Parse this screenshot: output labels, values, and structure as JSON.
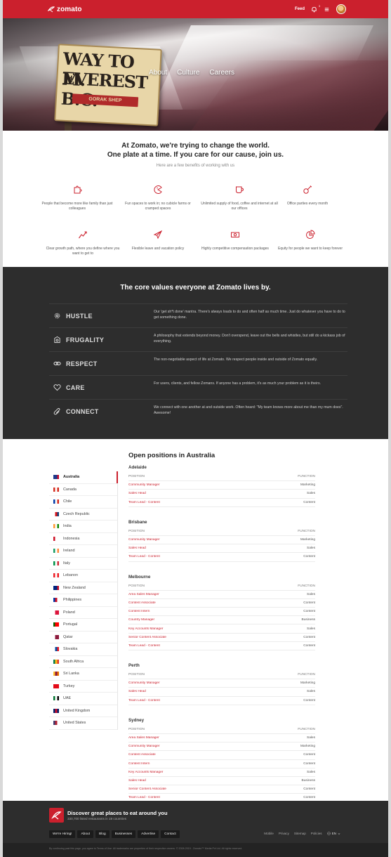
{
  "nav": {
    "logo": "zomato",
    "feed": "Feed",
    "notif_count": "3"
  },
  "hero": {
    "sign_line1": "WAY TO M.",
    "sign_line2": "EVEREST B.C.",
    "sign_line3": "GORAK SHEP",
    "links": [
      "About",
      "Culture",
      "Careers"
    ]
  },
  "intro": {
    "headline_1": "At Zomato, we're trying to change the world.",
    "headline_2": "One plate at a time. If you care for our cause, join us.",
    "subtitle": "Here are a few benefits of working with us",
    "benefits": [
      {
        "text": "People that become more like family than just colleagues",
        "icon": "puzzle-icon"
      },
      {
        "text": "Fun spaces to work in; no cubicle farms or cramped spaces",
        "icon": "pacman-icon"
      },
      {
        "text": "Unlimited supply of food, coffee and internet at all our offices",
        "icon": "coffee-cup-icon"
      },
      {
        "text": "Office parties every month",
        "icon": "guitar-icon"
      },
      {
        "text": "Clear growth path, where you define where you want to get to",
        "icon": "growth-chart-icon"
      },
      {
        "text": "Flexible leave and vacation policy",
        "icon": "airplane-icon"
      },
      {
        "text": "Highly competitive compensation packages",
        "icon": "money-icon"
      },
      {
        "text": "Equity for people we want to keep forever",
        "icon": "pie-chart-icon"
      }
    ]
  },
  "core": {
    "title": "The core values everyone at Zomato lives by.",
    "values": [
      {
        "name": "HUSTLE",
        "desc": "Our 'get sh*t done' mantra. There's always loads to do and often half as much time. Just do whatever you have to do to get something done.",
        "icon": "gear-icon"
      },
      {
        "name": "FRUGALITY",
        "desc": "A philosophy that extends beyond money. Don't overspend, leave out the bells and whistles, but still do a kickass job of everything.",
        "icon": "coin-icon"
      },
      {
        "name": "RESPECT",
        "desc": "The non-negotiable aspect of life at Zomato. We respect people inside and outside of Zomato equally.",
        "icon": "link-icon"
      },
      {
        "name": "CARE",
        "desc": "For users, clients, and fellow Zomans. If anyone has a problem, it's as much your problem as it is theirs.",
        "icon": "heart-icon"
      },
      {
        "name": "CONNECT",
        "desc": "We connect with one another at and outside work. Often heard: \"My team knows more about me than my mum does\". Awesome!",
        "icon": "paperclip-icon"
      }
    ]
  },
  "positions": {
    "title": "Open positions in Australia",
    "col_position": "POSITION",
    "col_function": "FUNCTION",
    "countries": [
      {
        "name": "Australia",
        "flag": [
          "#1f3a8a",
          "#1f3a8a",
          "#c8102e"
        ],
        "active": true
      },
      {
        "name": "Canada",
        "flag": [
          "#d52b1e",
          "#ffffff",
          "#d52b1e"
        ]
      },
      {
        "name": "Chile",
        "flag": [
          "#0039a6",
          "#ffffff",
          "#d52b1e"
        ]
      },
      {
        "name": "Czech Republic",
        "flag": [
          "#ffffff",
          "#d7141a",
          "#11457e"
        ]
      },
      {
        "name": "India",
        "flag": [
          "#ff9933",
          "#ffffff",
          "#138808"
        ]
      },
      {
        "name": "Indonesia",
        "flag": [
          "#ce1126",
          "#ffffff",
          "#ffffff"
        ]
      },
      {
        "name": "Ireland",
        "flag": [
          "#169b62",
          "#ffffff",
          "#ff883e"
        ]
      },
      {
        "name": "Italy",
        "flag": [
          "#009246",
          "#ffffff",
          "#ce2b37"
        ]
      },
      {
        "name": "Lebanon",
        "flag": [
          "#ed1c24",
          "#ffffff",
          "#ed1c24"
        ]
      },
      {
        "name": "New Zealand",
        "flag": [
          "#00247d",
          "#00247d",
          "#cc142b"
        ]
      },
      {
        "name": "Philippines",
        "flag": [
          "#0038a8",
          "#ce1126",
          "#ffffff"
        ]
      },
      {
        "name": "Poland",
        "flag": [
          "#ffffff",
          "#dc143c",
          "#dc143c"
        ]
      },
      {
        "name": "Portugal",
        "flag": [
          "#006600",
          "#ff0000",
          "#ff0000"
        ]
      },
      {
        "name": "Qatar",
        "flag": [
          "#ffffff",
          "#8d1b3d",
          "#8d1b3d"
        ]
      },
      {
        "name": "Slovakia",
        "flag": [
          "#ffffff",
          "#0b4ea2",
          "#ee1c25"
        ]
      },
      {
        "name": "South Africa",
        "flag": [
          "#007a4d",
          "#ffb612",
          "#de3831"
        ]
      },
      {
        "name": "Sri Lanka",
        "flag": [
          "#ffbe29",
          "#8d153a",
          "#eb7400"
        ]
      },
      {
        "name": "Turkey",
        "flag": [
          "#e30a17",
          "#e30a17",
          "#e30a17"
        ]
      },
      {
        "name": "UAE",
        "flag": [
          "#00732f",
          "#ffffff",
          "#000000"
        ]
      },
      {
        "name": "United Kingdom",
        "flag": [
          "#012169",
          "#c8102e",
          "#012169"
        ]
      },
      {
        "name": "United States",
        "flag": [
          "#3c3b6e",
          "#b22234",
          "#ffffff"
        ]
      }
    ],
    "cities": [
      {
        "name": "Adelaide",
        "jobs": [
          {
            "title": "Community Manager",
            "function": "Marketing"
          },
          {
            "title": "Sales Head",
            "function": "Sales"
          },
          {
            "title": "Team Lead - Content",
            "function": "Content"
          }
        ]
      },
      {
        "name": "Brisbane",
        "jobs": [
          {
            "title": "Community Manager",
            "function": "Marketing"
          },
          {
            "title": "Sales Head",
            "function": "Sales"
          },
          {
            "title": "Team Lead - Content",
            "function": "Content"
          }
        ]
      },
      {
        "name": "Melbourne",
        "jobs": [
          {
            "title": "Area Sales Manager",
            "function": "Sales"
          },
          {
            "title": "Content Associate",
            "function": "Content"
          },
          {
            "title": "Content Intern",
            "function": "Content"
          },
          {
            "title": "Country Manager",
            "function": "Business"
          },
          {
            "title": "Key Accounts Manager",
            "function": "Sales"
          },
          {
            "title": "Senior Content Associate",
            "function": "Content"
          },
          {
            "title": "Team Lead - Content",
            "function": "Content"
          }
        ]
      },
      {
        "name": "Perth",
        "jobs": [
          {
            "title": "Community Manager",
            "function": "Marketing"
          },
          {
            "title": "Sales Head",
            "function": "Sales"
          },
          {
            "title": "Team Lead - Content",
            "function": "Content"
          }
        ]
      },
      {
        "name": "Sydney",
        "jobs": [
          {
            "title": "Area Sales Manager",
            "function": "Sales"
          },
          {
            "title": "Community Manager",
            "function": "Marketing"
          },
          {
            "title": "Content Associate",
            "function": "Content"
          },
          {
            "title": "Content Intern",
            "function": "Content"
          },
          {
            "title": "Key Accounts Manager",
            "function": "Sales"
          },
          {
            "title": "Sales Head",
            "function": "Business"
          },
          {
            "title": "Senior Content Associate",
            "function": "Content"
          },
          {
            "title": "Team Lead - Content",
            "function": "Content"
          }
        ]
      }
    ]
  },
  "footer": {
    "title": "Discover great places to eat around you",
    "subtitle": "330,700 listed restaurants in 19 countries",
    "links": [
      "We're Hiring!",
      "About",
      "Blog",
      "Businesses",
      "Advertise",
      "Contact"
    ],
    "right_links": [
      "Mobile",
      "Privacy",
      "Sitemap",
      "Policies"
    ],
    "lang": "EN",
    "legal": "By continuing past this page, you agree to Terms of Use. All trademarks are properties of their respective owners. © 2008-2015 - Zomato™ Media Pvt Ltd. All rights reserved."
  },
  "colors": {
    "brand_red": "#cb202d",
    "dark": "#2d2d2d"
  }
}
